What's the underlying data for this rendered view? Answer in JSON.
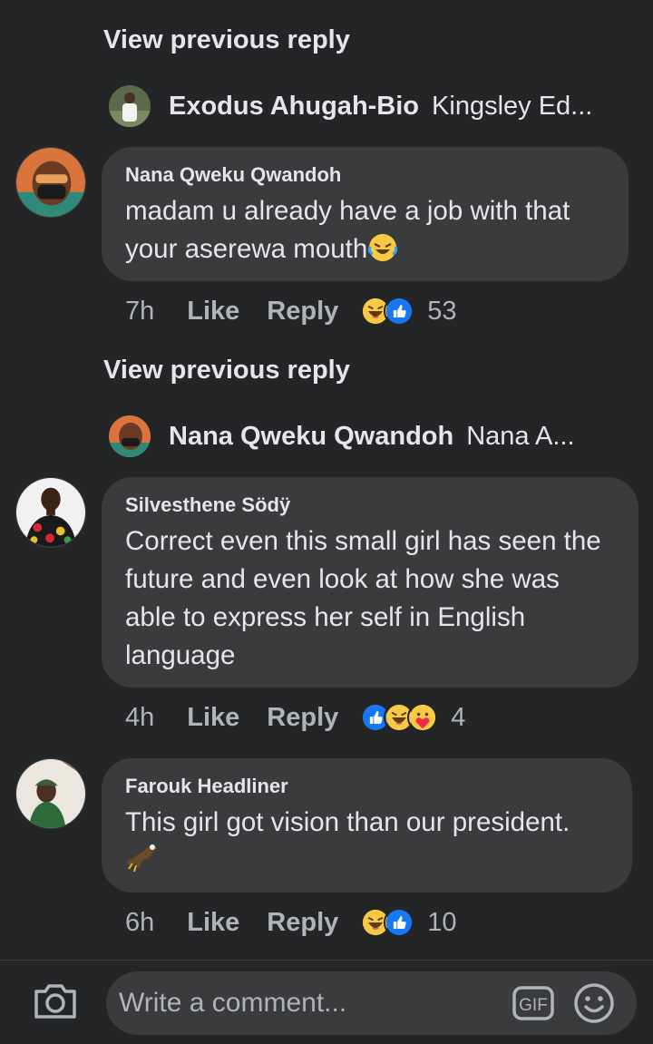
{
  "thread": {
    "view_previous_1": "View previous reply",
    "collapsed_1": {
      "name": "Exodus Ahugah-Bio",
      "preview": "Kingsley Ed..."
    },
    "view_previous_2": "View previous reply",
    "collapsed_2": {
      "name": "Nana Qweku Qwandoh",
      "preview": "Nana A..."
    }
  },
  "comments": [
    {
      "author": "Nana Qweku Qwandoh",
      "text": "madam u already have a job with that your aserewa mouth",
      "time": "7h",
      "like": "Like",
      "reply": "Reply",
      "reactions": [
        "haha",
        "like"
      ],
      "count": "53"
    },
    {
      "author": "Silvesthene Södÿ",
      "text": "Correct even this small girl has seen the future and even look at how she was able to express her self in English language",
      "time": "4h",
      "like": "Like",
      "reply": "Reply",
      "reactions": [
        "like",
        "haha",
        "care"
      ],
      "count": "4"
    },
    {
      "author": "Farouk Headliner",
      "text": "This girl got vision than our president.",
      "time": "6h",
      "like": "Like",
      "reply": "Reply",
      "reactions": [
        "haha",
        "like"
      ],
      "count": "10"
    }
  ],
  "composer": {
    "placeholder": "Write a comment...",
    "gif_label": "GIF"
  },
  "colors": {
    "background": "#242526",
    "bubble": "#3a3b3c",
    "text": "#e4e6eb",
    "meta": "#b0b3b8",
    "like_blue": "#1877f2",
    "haha_yellow": "#f7c944"
  }
}
